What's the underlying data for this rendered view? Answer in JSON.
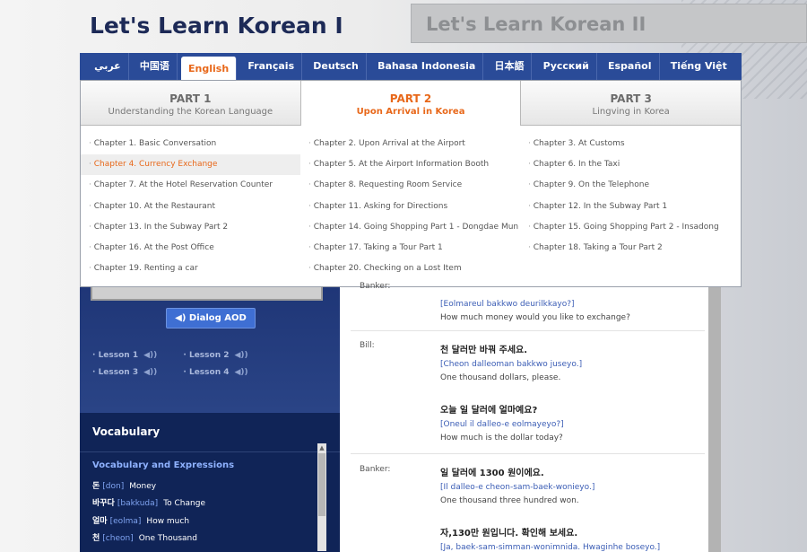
{
  "header": {
    "title_1": "Let's Learn Korean I",
    "title_2": "Let's Learn Korean II"
  },
  "languages": [
    "عربي",
    "中国语",
    "English",
    "Français",
    "Deutsch",
    "Bahasa Indonesia",
    "日本語",
    "Русский",
    "Español",
    "Tiếng Việt"
  ],
  "parts": [
    {
      "title": "PART 1",
      "subtitle": "Understanding the Korean Language"
    },
    {
      "title": "PART 2",
      "subtitle": "Upon Arrival in Korea"
    },
    {
      "title": "PART 3",
      "subtitle": "Lingving in Korea"
    }
  ],
  "chapters": [
    "Chapter 1. Basic Conversation",
    "Chapter 2. Upon Arrival at the Airport",
    "Chapter 3. At Customs",
    "Chapter 4. Currency Exchange",
    "Chapter 5. At the Airport Information Booth",
    "Chapter 6. In the Taxi",
    "Chapter 7. At the Hotel Reservation Counter",
    "Chapter 8. Requesting Room Service",
    "Chapter 9. On the Telephone",
    "Chapter 10. At the Restaurant",
    "Chapter 11. Asking for Directions",
    "Chapter 12. In the Subway Part 1",
    "Chapter 13. In the Subway Part 2",
    "Chapter 14. Going Shopping Part 1 - Dongdae Mun",
    "Chapter 15. Going Shopping Part 2 - Insadong",
    "Chapter 16. At the Post Office",
    "Chapter 17. Taking a Tour Part 1",
    "Chapter 18. Taking a Tour Part 2",
    "Chapter 19. Renting a car",
    "Chapter 20. Checking on a Lost Item"
  ],
  "left": {
    "aod_label": "Dialog AOD",
    "lessons": [
      "Lesson 1",
      "Lesson 2",
      "Lesson 3",
      "Lesson 4"
    ],
    "vocab_title": "Vocabulary",
    "vocab_subtitle": "Vocabulary and Expressions",
    "vocab": [
      {
        "ko": "돈",
        "rom": "[don]",
        "en": "Money"
      },
      {
        "ko": "바꾸다",
        "rom": "[bakkuda]",
        "en": "To Change"
      },
      {
        "ko": "얼마",
        "rom": "[eolma]",
        "en": "How much"
      },
      {
        "ko": "천",
        "rom": "[cheon]",
        "en": "One Thousand"
      }
    ]
  },
  "dialog": {
    "partial_speaker": "Banker:",
    "partial_rom": "[Eolmareul bakkwo deurilkkayo?]",
    "partial_en": "How much money would you like to exchange?",
    "bill_speaker": "Bill:",
    "bill_1_ko": "천 달러만 바꿔 주세요.",
    "bill_1_rom": "[Cheon dalleoman bakkwo juseyo.]",
    "bill_1_en": "One thousand dollars, please.",
    "bill_2_ko": "오늘 일 달러에 얼마예요?",
    "bill_2_rom": "[Oneul il dalleo-e eolmayeyo?]",
    "bill_2_en": "How much is the dollar today?",
    "banker_speaker": "Banker:",
    "banker_1_ko": "일 달러에 1300 원이에요.",
    "banker_1_rom": "[Il dalleo-e cheon-sam-baek-wonieyo.]",
    "banker_1_en": "One thousand three hundred won.",
    "banker_2_ko": "자,130만 원입니다. 확인해 보세요.",
    "banker_2_rom": "[Ja, baek-sam-simman-wonimnida. Hwaginhe boseyo.]"
  }
}
